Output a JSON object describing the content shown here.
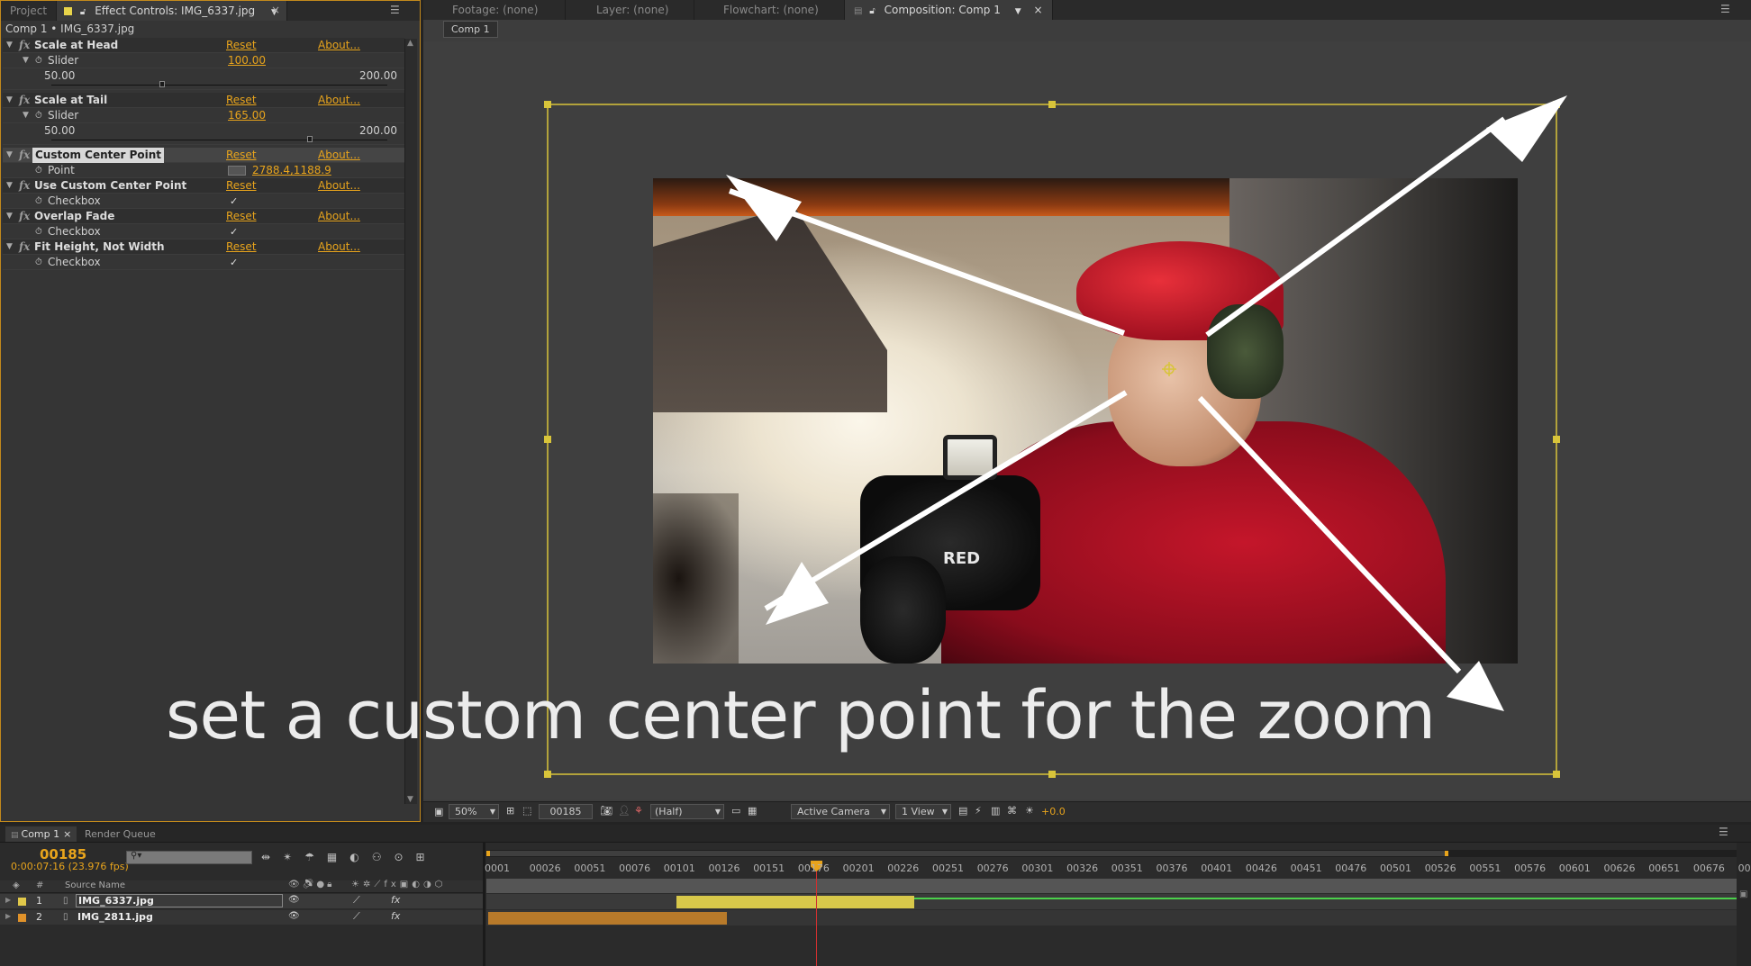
{
  "ec_panel": {
    "tabs": [
      "Project",
      "Effect Controls: IMG_6337.jpg"
    ],
    "breadcrumb": "Comp 1 • IMG_6337.jpg",
    "effects": [
      {
        "name": "Scale at Head",
        "reset": "Reset",
        "about": "About...",
        "param": "Slider",
        "value": "100.00",
        "min": "50.00",
        "max": "200.00",
        "level": 0.33
      },
      {
        "name": "Scale at Tail",
        "reset": "Reset",
        "about": "About...",
        "param": "Slider",
        "value": "165.00",
        "min": "50.00",
        "max": "200.00",
        "level": 0.77
      },
      {
        "name": "Custom Center Point",
        "reset": "Reset",
        "about": "About...",
        "param": "Point",
        "value": "2788.4,1188.9"
      },
      {
        "name": "Use Custom Center Point",
        "reset": "Reset",
        "about": "About...",
        "param": "Checkbox",
        "check": "✓"
      },
      {
        "name": "Overlap Fade",
        "reset": "Reset",
        "about": "About...",
        "param": "Checkbox",
        "check": "✓"
      },
      {
        "name": "Fit Height, Not Width",
        "reset": "Reset",
        "about": "About...",
        "param": "Checkbox",
        "check": "✓"
      }
    ]
  },
  "viewer": {
    "tabs": [
      "Footage: (none)",
      "Layer: (none)",
      "Flowchart: (none)",
      "Composition: Comp 1"
    ],
    "comp_button": "Comp 1",
    "caption": "set a custom center point for the zoom",
    "photo_text": "RED",
    "bottom_bar": {
      "zoom": "50%",
      "frame": "00185",
      "resolution": "(Half)",
      "camera": "Active Camera",
      "views": "1 View",
      "exposure": "+0.0"
    }
  },
  "timeline": {
    "tabs": [
      "Comp 1",
      "Render Queue"
    ],
    "current_frame": "00185",
    "timecode": "0:00:07:16 (23.976 fps)",
    "column_hash": "#",
    "column_source": "Source Name",
    "ruler": [
      "0001",
      "00026",
      "00051",
      "00076",
      "00101",
      "00126",
      "00151",
      "00176",
      "00201",
      "00226",
      "00251",
      "00276",
      "00301",
      "00326",
      "00351",
      "00376",
      "00401",
      "00426",
      "00451",
      "00476",
      "00501",
      "00526",
      "00551",
      "00576",
      "00601",
      "00626",
      "00651",
      "00676",
      "00"
    ],
    "layers": [
      {
        "num": "1",
        "name": "IMG_6337.jpg",
        "color": "#e0c84a"
      },
      {
        "num": "2",
        "name": "IMG_2811.jpg",
        "color": "#e0922a"
      }
    ]
  },
  "colors": {
    "accent": "#e8a41c",
    "panel_border": "#c2891c",
    "bounding_box": "#d8c43a"
  }
}
